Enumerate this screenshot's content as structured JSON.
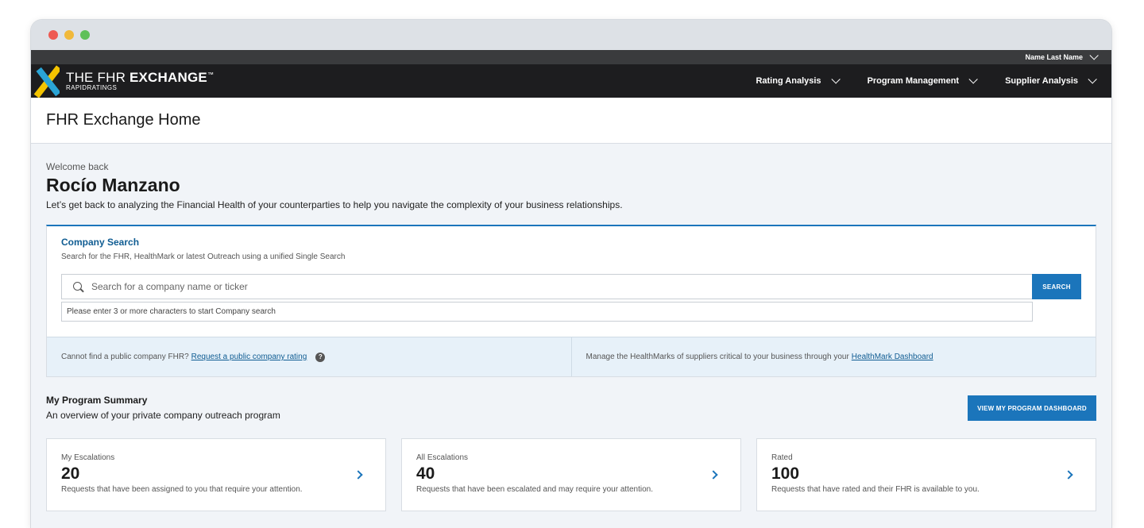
{
  "user_bar": {
    "user_name": "Name Last Name"
  },
  "brand": {
    "title_light": "THE FHR ",
    "title_bold": "EXCHANGE",
    "trademark": "™",
    "subtitle": "RAPIDRATINGS"
  },
  "nav": {
    "items": [
      {
        "label": "Rating Analysis"
      },
      {
        "label": "Program Management"
      },
      {
        "label": "Supplier Analysis"
      }
    ]
  },
  "page": {
    "title": "FHR Exchange Home"
  },
  "welcome": {
    "greeting": "Welcome back",
    "name": "Rocío Manzano",
    "message": "Let’s get back to analyzing the Financial Health of your counterparties to help you navigate the complexity of your business relationships."
  },
  "company_search": {
    "title": "Company Search",
    "subtitle": "Search for the FHR, HealthMark or latest Outreach using a unified Single Search",
    "placeholder": "Search for a company name or ticker",
    "value": "",
    "button_label": "SEARCH",
    "hint": "Please enter 3 or more characters to start Company search"
  },
  "info": {
    "left_text": "Cannot find a public company FHR?",
    "left_link": "Request a public company rating",
    "help_glyph": "?",
    "right_text": "Manage the HealthMarks of suppliers critical to your business through your",
    "right_link": "HealthMark Dashboard"
  },
  "program_summary": {
    "title": "My Program Summary",
    "subtitle": "An overview of your private company outreach program",
    "button_label": "VIEW MY PROGRAM DASHBOARD",
    "cards": [
      {
        "label": "My Escalations",
        "value": "20",
        "description": "Requests that have been assigned to you that require your attention."
      },
      {
        "label": "All Escalations",
        "value": "40",
        "description": "Requests that have been escalated and may require your attention."
      },
      {
        "label": "Rated",
        "value": "100",
        "description": "Requests that have rated and their FHR is available to you."
      }
    ]
  },
  "colors": {
    "accent": "#1b75bb",
    "nav_bg": "#1d1d1f",
    "logo_yellow": "#f4c400",
    "logo_blue": "#2aa4d5"
  },
  "icons": {
    "search": "search-icon",
    "help": "help-icon",
    "chevron_down": "chevron-down-icon",
    "chevron_right": "chevron-right-icon"
  }
}
